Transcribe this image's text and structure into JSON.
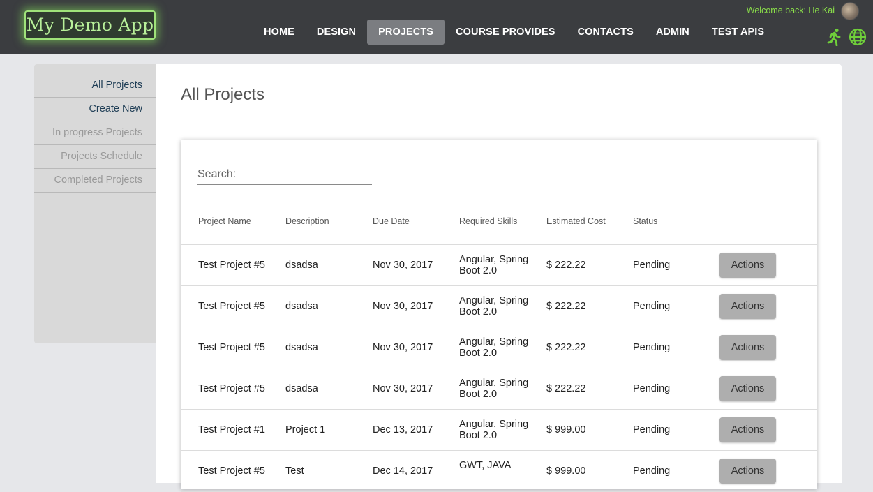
{
  "header": {
    "logo": "My Demo App",
    "nav": [
      "HOME",
      "DESIGN",
      "PROJECTS",
      "COURSE PROVIDES",
      "CONTACTS",
      "ADMIN",
      "TEST APIS"
    ],
    "active_nav": "PROJECTS",
    "welcome": "Welcome back: He Kai"
  },
  "sidebar": {
    "items": [
      {
        "label": "All Projects",
        "enabled": true
      },
      {
        "label": "Create New",
        "enabled": true
      },
      {
        "label": "In progress Projects",
        "enabled": false
      },
      {
        "label": "Projects Schedule",
        "enabled": false
      },
      {
        "label": "Completed Projects",
        "enabled": false
      }
    ]
  },
  "main": {
    "title": "All Projects",
    "search": {
      "placeholder": "Search:",
      "value": ""
    },
    "columns": [
      "Project Name",
      "Description",
      "Due Date",
      "Required Skills",
      "Estimated Cost",
      "Status"
    ],
    "action_label": "Actions",
    "rows": [
      {
        "name": "Test Project #5",
        "description": "dsadsa",
        "due": "Nov 30, 2017",
        "skills": "Angular, Spring Boot 2.0",
        "cost": "$ 222.22",
        "status": "Pending"
      },
      {
        "name": "Test Project #5",
        "description": "dsadsa",
        "due": "Nov 30, 2017",
        "skills": "Angular, Spring Boot 2.0",
        "cost": "$ 222.22",
        "status": "Pending"
      },
      {
        "name": "Test Project #5",
        "description": "dsadsa",
        "due": "Nov 30, 2017",
        "skills": "Angular, Spring Boot 2.0",
        "cost": "$ 222.22",
        "status": "Pending"
      },
      {
        "name": "Test Project #5",
        "description": "dsadsa",
        "due": "Nov 30, 2017",
        "skills": "Angular, Spring Boot 2.0",
        "cost": "$ 222.22",
        "status": "Pending"
      },
      {
        "name": "Test Project #1",
        "description": "Project 1",
        "due": "Dec 13, 2017",
        "skills": "Angular, Spring Boot 2.0",
        "cost": "$ 999.00",
        "status": "Pending"
      },
      {
        "name": "Test Project #5",
        "description": "Test",
        "due": "Dec 14, 2017",
        "skills": "GWT, JAVA",
        "cost": "$ 999.00",
        "status": "Pending"
      }
    ]
  },
  "colors": {
    "header_bg": "#3b3d40",
    "accent_green": "#8be04a",
    "active_nav_bg": "#7b7d81",
    "button_bg": "#aeaeae"
  },
  "icons": [
    "running-person-icon",
    "globe-icon",
    "user-avatar"
  ]
}
